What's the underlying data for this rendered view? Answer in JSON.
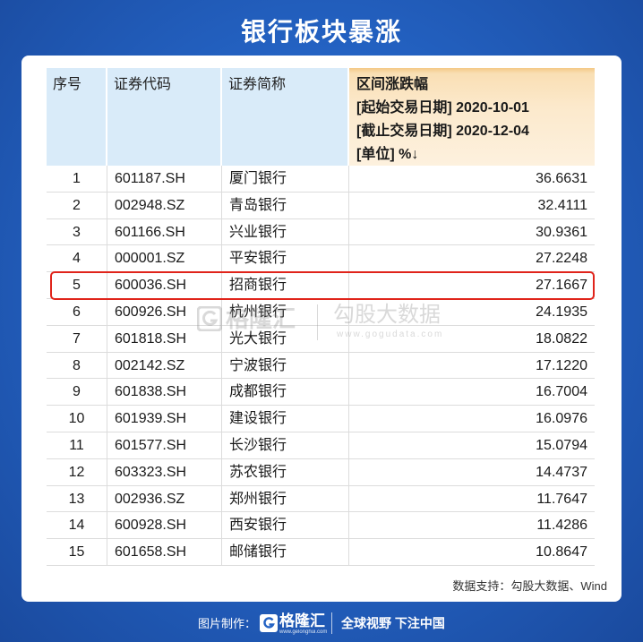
{
  "title": "银行板块暴涨",
  "chart_data": {
    "type": "table",
    "headers": {
      "rank": "序号",
      "code": "证券代码",
      "name": "证券简称",
      "value": [
        "区间涨跌幅",
        "[起始交易日期] 2020-10-01",
        "[截止交易日期] 2020-12-04",
        "[单位] %↓"
      ]
    },
    "rows": [
      {
        "rank": 1,
        "code": "601187.SH",
        "name": "厦门银行",
        "value": 36.6631
      },
      {
        "rank": 2,
        "code": "002948.SZ",
        "name": "青岛银行",
        "value": 32.4111
      },
      {
        "rank": 3,
        "code": "601166.SH",
        "name": "兴业银行",
        "value": 30.9361
      },
      {
        "rank": 4,
        "code": "000001.SZ",
        "name": "平安银行",
        "value": 27.2248
      },
      {
        "rank": 5,
        "code": "600036.SH",
        "name": "招商银行",
        "value": 27.1667
      },
      {
        "rank": 6,
        "code": "600926.SH",
        "name": "杭州银行",
        "value": 24.1935
      },
      {
        "rank": 7,
        "code": "601818.SH",
        "name": "光大银行",
        "value": 18.0822
      },
      {
        "rank": 8,
        "code": "002142.SZ",
        "name": "宁波银行",
        "value": 17.122
      },
      {
        "rank": 9,
        "code": "601838.SH",
        "name": "成都银行",
        "value": 16.7004
      },
      {
        "rank": 10,
        "code": "601939.SH",
        "name": "建设银行",
        "value": 16.0976
      },
      {
        "rank": 11,
        "code": "601577.SH",
        "name": "长沙银行",
        "value": 15.0794
      },
      {
        "rank": 12,
        "code": "603323.SH",
        "name": "苏农银行",
        "value": 14.4737
      },
      {
        "rank": 13,
        "code": "002936.SZ",
        "name": "郑州银行",
        "value": 11.7647
      },
      {
        "rank": 14,
        "code": "600928.SH",
        "name": "西安银行",
        "value": 11.4286
      },
      {
        "rank": 15,
        "code": "601658.SH",
        "name": "邮储银行",
        "value": 10.8647
      }
    ],
    "highlight_rank": 5
  },
  "source": "数据支持：勾股大数据、Wind",
  "watermark": {
    "brand": "格隆汇",
    "name": "勾股大数据",
    "url": "www.gogudata.com"
  },
  "footer": {
    "label": "图片制作：",
    "brand": "格隆汇",
    "brand_url": "www.gelonghui.com",
    "slogan": "全球视野 下注中国"
  },
  "icons": {
    "footer_logo": "gelonghui-logo-icon",
    "watermark_logo": "gelonghui-logo-icon"
  },
  "colors": {
    "background": "#2463c4",
    "header_blue": "#d9ebf9",
    "header_orange": "#fce9cc",
    "highlight_border": "#e0241b"
  }
}
